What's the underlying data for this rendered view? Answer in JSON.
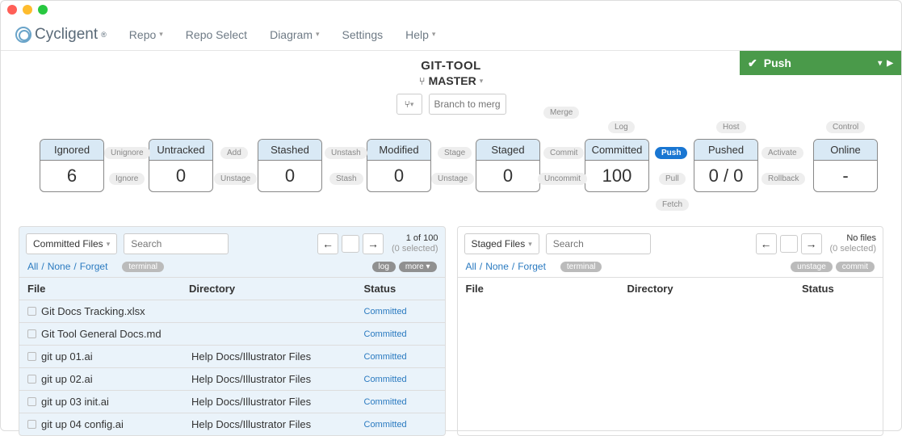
{
  "titlebar": {},
  "menu": {
    "logo": "Cycligent",
    "items": [
      "Repo",
      "Repo Select",
      "Diagram",
      "Settings",
      "Help"
    ],
    "has_caret": [
      true,
      false,
      true,
      false,
      true
    ]
  },
  "header": {
    "repo": "GIT-TOOL",
    "branch": "MASTER",
    "merge_placeholder": "Branch to merge",
    "push_label": "Push"
  },
  "diagram": {
    "boxes": [
      {
        "label": "Ignored",
        "value": "6"
      },
      {
        "label": "Untracked",
        "value": "0"
      },
      {
        "label": "Stashed",
        "value": "0"
      },
      {
        "label": "Modified",
        "value": "0"
      },
      {
        "label": "Staged",
        "value": "0"
      },
      {
        "label": "Committed",
        "value": "100"
      },
      {
        "label": "Pushed",
        "value": "0 / 0"
      },
      {
        "label": "Online",
        "value": "-"
      }
    ],
    "pills": {
      "unignore": "Unignore",
      "ignore": "Ignore",
      "add": "Add",
      "unstage": "Unstage",
      "unstash": "Unstash",
      "stash": "Stash",
      "stage": "Stage",
      "unstage2": "Unstage",
      "commit": "Commit",
      "uncommit": "Uncommit",
      "merge": "Merge",
      "log": "Log",
      "push": "Push",
      "pull": "Pull",
      "fetch": "Fetch",
      "host": "Host",
      "activate": "Activate",
      "rollback": "Rollback",
      "control": "Control"
    }
  },
  "panels": {
    "left": {
      "dropdown": "Committed Files",
      "search_ph": "Search",
      "info1": "1 of 100",
      "info2": "(0 selected)",
      "links": {
        "all": "All",
        "none": "None",
        "forget": "Forget"
      },
      "terminal": "terminal",
      "log": "log",
      "more": "more",
      "cols": {
        "file": "File",
        "dir": "Directory",
        "status": "Status"
      },
      "rows": [
        {
          "file": "Git Docs Tracking.xlsx",
          "dir": "",
          "status": "Committed"
        },
        {
          "file": "Git Tool General Docs.md",
          "dir": "",
          "status": "Committed"
        },
        {
          "file": "git up 01.ai",
          "dir": "Help Docs/Illustrator Files",
          "status": "Committed"
        },
        {
          "file": "git up 02.ai",
          "dir": "Help Docs/Illustrator Files",
          "status": "Committed"
        },
        {
          "file": "git up 03 init.ai",
          "dir": "Help Docs/Illustrator Files",
          "status": "Committed"
        },
        {
          "file": "git up 04 config.ai",
          "dir": "Help Docs/Illustrator Files",
          "status": "Committed"
        }
      ]
    },
    "right": {
      "dropdown": "Staged Files",
      "search_ph": "Search",
      "info1": "No files",
      "info2": "(0 selected)",
      "links": {
        "all": "All",
        "none": "None",
        "forget": "Forget"
      },
      "terminal": "terminal",
      "unstage": "unstage",
      "commit": "commit",
      "cols": {
        "file": "File",
        "dir": "Directory",
        "status": "Status"
      }
    }
  }
}
